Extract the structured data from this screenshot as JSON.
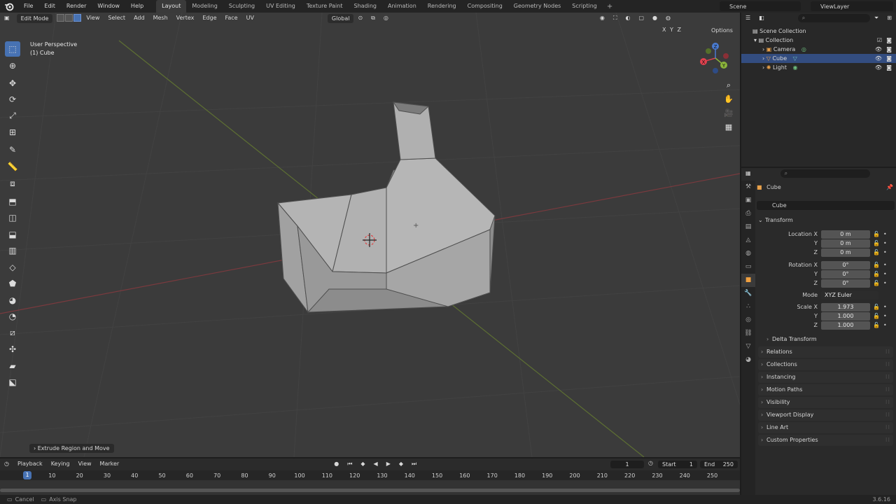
{
  "topbar": {
    "menus": [
      "File",
      "Edit",
      "Render",
      "Window",
      "Help"
    ],
    "workspaces": [
      "Layout",
      "Modeling",
      "Sculpting",
      "UV Editing",
      "Texture Paint",
      "Shading",
      "Animation",
      "Rendering",
      "Compositing",
      "Geometry Nodes",
      "Scripting"
    ],
    "active_workspace": "Layout",
    "add_tab": "+",
    "scene": "Scene",
    "view_layer": "ViewLayer"
  },
  "viewport": {
    "mode": "Edit Mode",
    "menus": [
      "View",
      "Select",
      "Add",
      "Mesh",
      "Vertex",
      "Edge",
      "Face",
      "UV"
    ],
    "transform_orientation": "Global",
    "overlay_title": "User Perspective",
    "overlay_object": "(1) Cube",
    "mirror_axes": "X Y Z",
    "options_label": "Options",
    "last_operator": "Extrude Region and Move",
    "gizmo": {
      "x": "X",
      "y": "Y",
      "z": "Z"
    }
  },
  "timeline": {
    "menus": [
      "Playback",
      "Keying",
      "View",
      "Marker"
    ],
    "current_frame": "1",
    "start_label": "Start",
    "start_value": "1",
    "end_label": "End",
    "end_value": "250",
    "ticks": [
      "10",
      "20",
      "30",
      "40",
      "50",
      "60",
      "70",
      "80",
      "90",
      "100",
      "110",
      "120",
      "130",
      "140",
      "150",
      "160",
      "170",
      "180",
      "190",
      "200",
      "210",
      "220",
      "230",
      "240",
      "250"
    ],
    "indicator": "1"
  },
  "statusbar": {
    "cancel": "Cancel",
    "axis_snap": "Axis Snap",
    "version": "3.6.16"
  },
  "outliner": {
    "rows": [
      {
        "label": "Scene Collection"
      },
      {
        "label": "Collection"
      },
      {
        "label": "Camera"
      },
      {
        "label": "Cube"
      },
      {
        "label": "Light"
      }
    ]
  },
  "properties": {
    "object_name": "Cube",
    "name_field": "Cube",
    "transform_label": "Transform",
    "location": {
      "label": "Location X",
      "x": "0 m",
      "y": "0 m",
      "z": "0 m"
    },
    "rotation": {
      "label": "Rotation X",
      "x": "0°",
      "y": "0°",
      "z": "0°"
    },
    "mode_label": "Mode",
    "mode_value": "XYZ Euler",
    "scale": {
      "label": "Scale X",
      "x": "1.973",
      "y": "1.000",
      "z": "1.000"
    },
    "axis_y": "Y",
    "axis_z": "Z",
    "panels": [
      "Delta Transform",
      "Relations",
      "Collections",
      "Instancing",
      "Motion Paths",
      "Visibility",
      "Viewport Display",
      "Line Art",
      "Custom Properties"
    ]
  },
  "colors": {
    "accent": "#4772b3",
    "selected_row": "#334d80",
    "axis_x": "#e0414e",
    "axis_y": "#8bb43b",
    "axis_z": "#4a7bd0"
  }
}
